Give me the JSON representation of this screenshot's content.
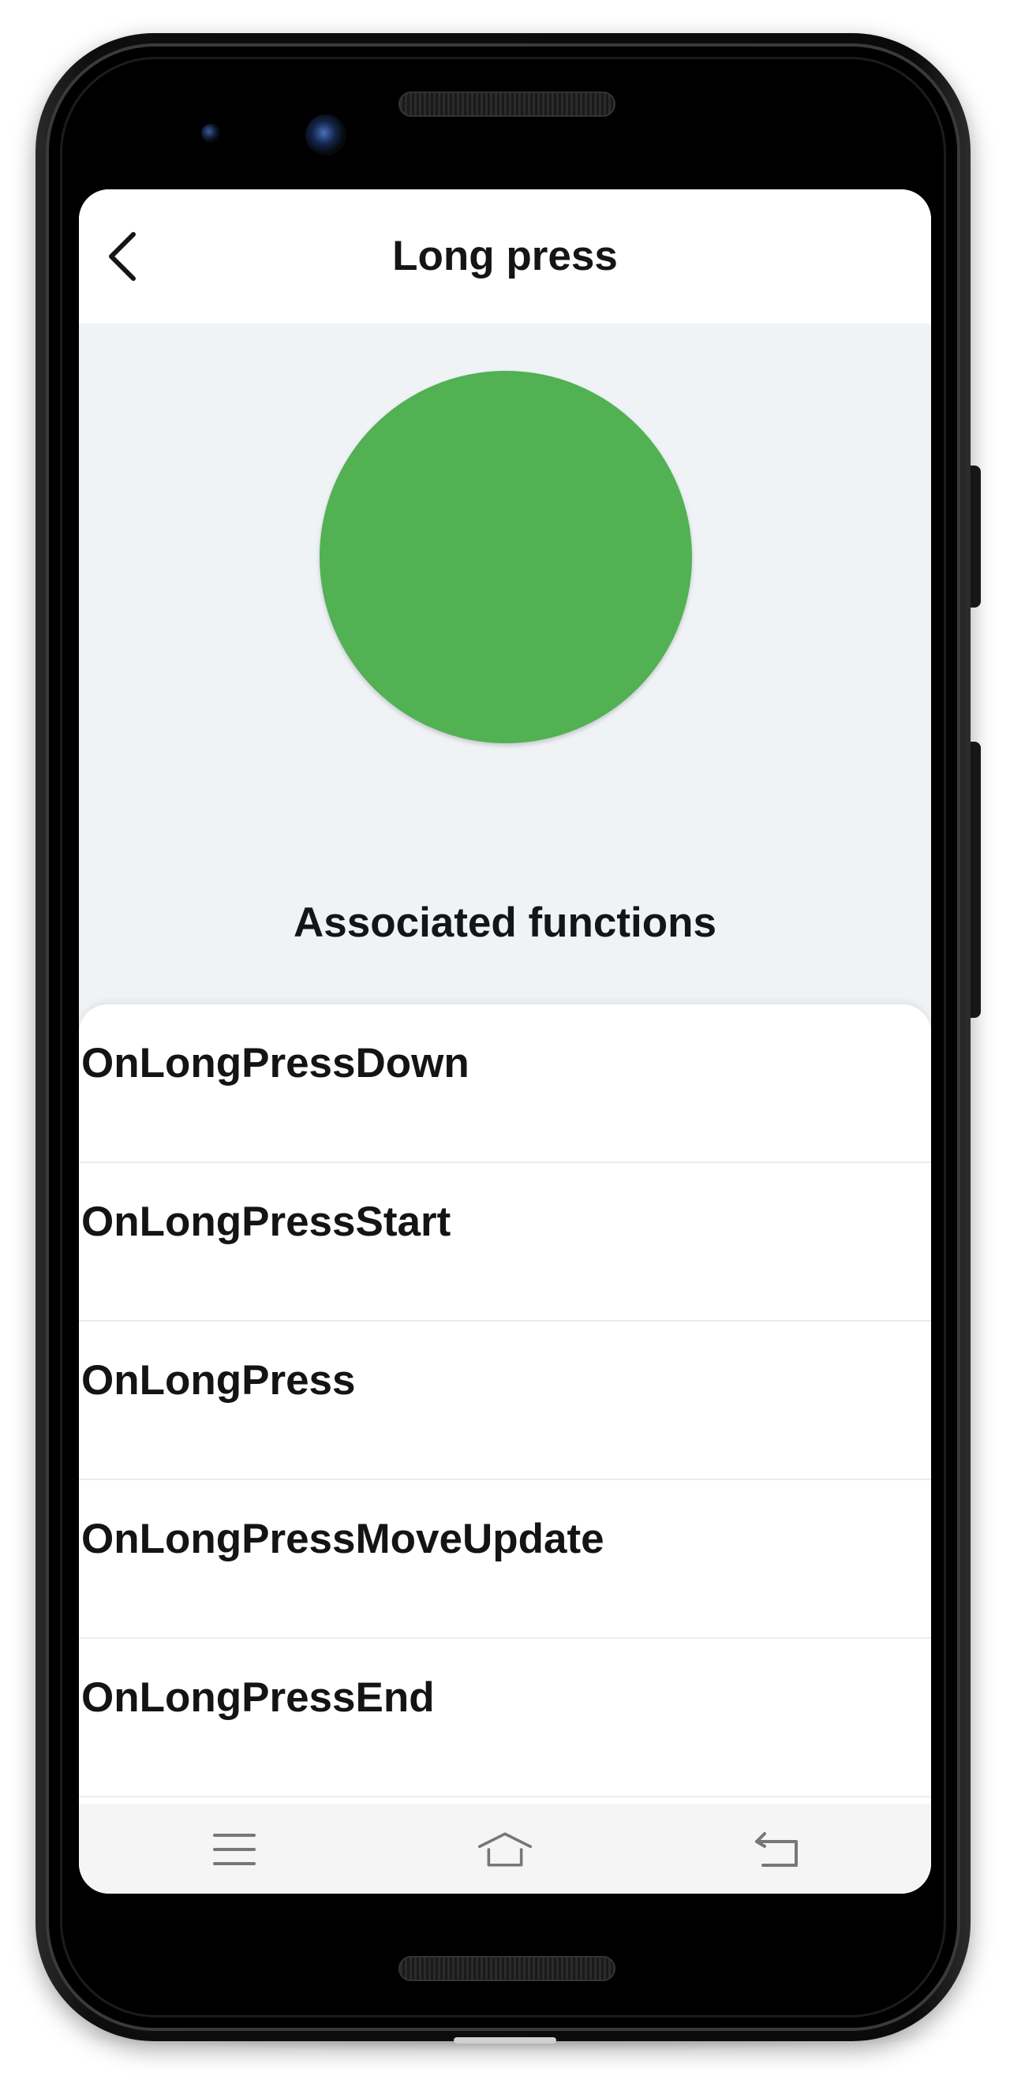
{
  "app": {
    "title": "Long press"
  },
  "demo": {
    "circle_color": "#51b153",
    "section_title": "Associated functions"
  },
  "functions": [
    {
      "label": "OnLongPressDown"
    },
    {
      "label": "OnLongPressStart"
    },
    {
      "label": "OnLongPress"
    },
    {
      "label": "OnLongPressMoveUpdate"
    },
    {
      "label": "OnLongPressEnd"
    }
  ],
  "navbar": {
    "icons": [
      "menu-icon",
      "home-icon",
      "back-icon"
    ]
  },
  "colors": {
    "background": "#eff3f6",
    "text": "#151515",
    "accent": "#51b153"
  }
}
